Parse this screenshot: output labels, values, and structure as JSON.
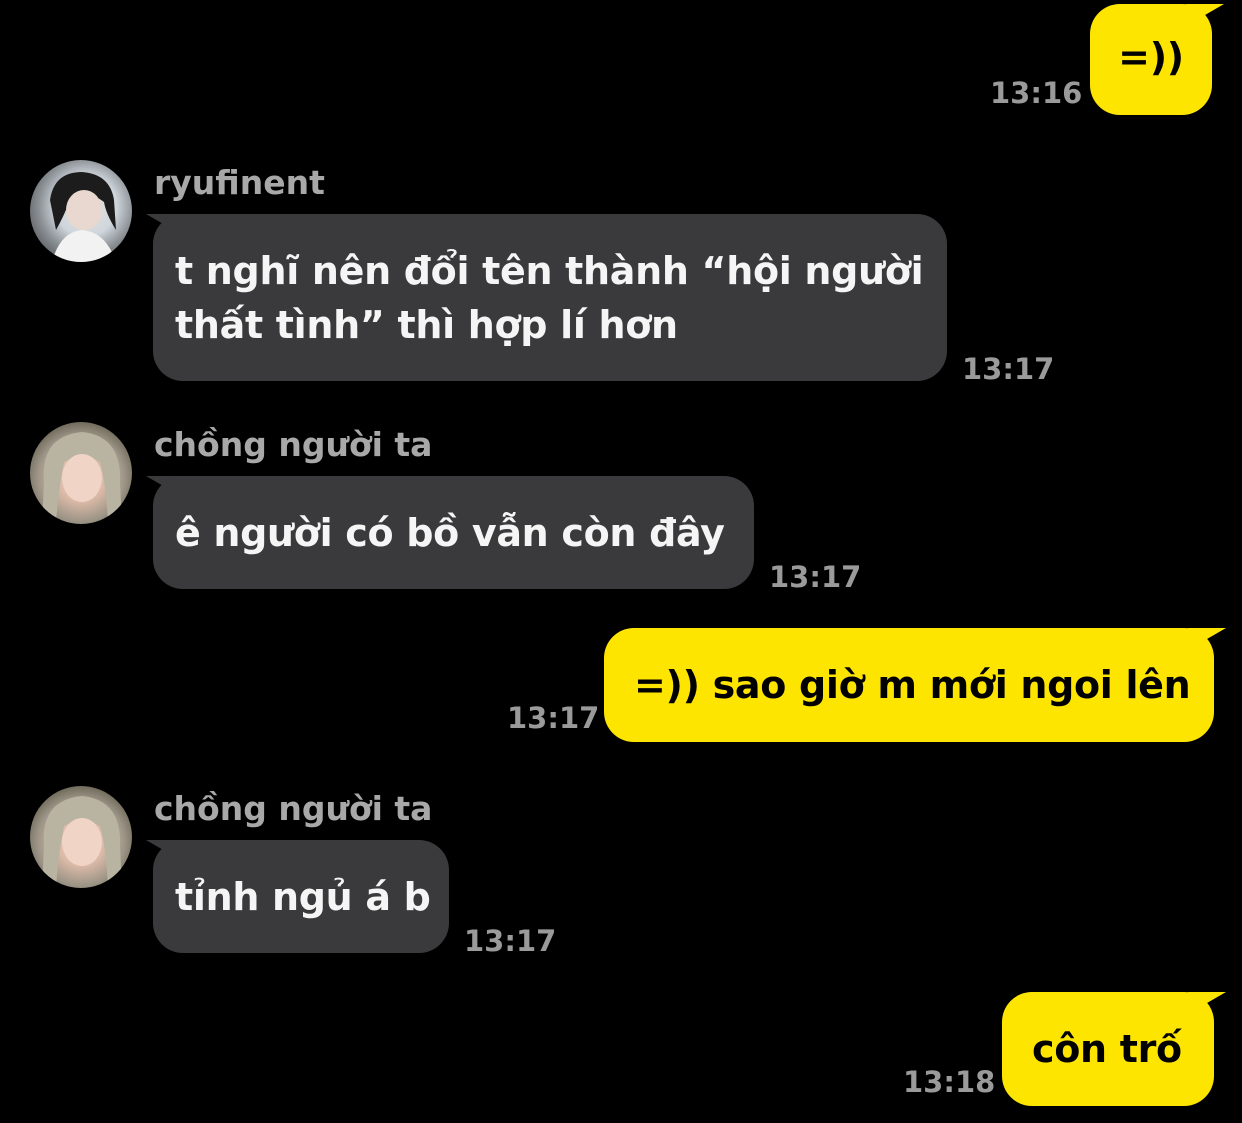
{
  "conversation": {
    "messages": [
      {
        "type": "outgoing",
        "text": "=))",
        "time": "13:16"
      },
      {
        "type": "incoming",
        "sender": "ryufinent",
        "avatar": "ryufinent-avatar",
        "lines": [
          "t nghĩ nên đổi tên thành “hội người",
          "thất tình” thì hợp lí hơn"
        ],
        "time": "13:17"
      },
      {
        "type": "incoming",
        "sender": "chồng người ta",
        "avatar": "chong-nguoi-ta-avatar",
        "text": "ê người có bồ vẫn còn đây",
        "time": "13:17"
      },
      {
        "type": "outgoing",
        "text": "=)) sao giờ m mới ngoi lên",
        "time": "13:17"
      },
      {
        "type": "incoming",
        "sender": "chồng người ta",
        "avatar": "chong-nguoi-ta-avatar",
        "text": "tỉnh ngủ á b",
        "time": "13:17"
      },
      {
        "type": "outgoing",
        "text": "côn trố",
        "time": "13:18"
      }
    ]
  },
  "colors": {
    "background": "#000000",
    "incoming_bubble": "#3a3a3c",
    "outgoing_bubble": "#fee500",
    "timestamp": "#9a9a9a",
    "sender_name": "#a8a8a8"
  }
}
